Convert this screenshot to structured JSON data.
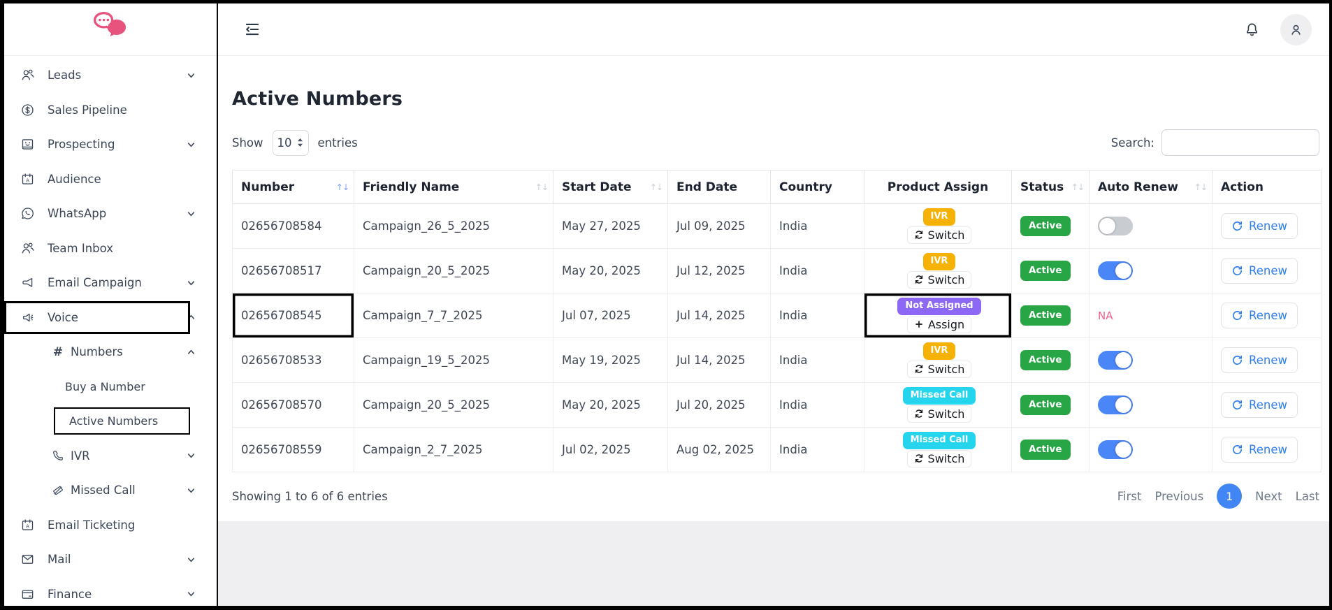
{
  "colors": {
    "brand_pink": "#e8537e",
    "ivr_badge": "#f6b105",
    "missed_call_badge": "#25d4ed",
    "not_assigned_badge": "#8d68f4",
    "active_badge": "#28a544",
    "toggle_on": "#4a86f7",
    "renew_blue": "#2f80ed",
    "na_pink": "#f0608c",
    "pagination_blue": "#4285f4"
  },
  "sidebar": {
    "items": [
      {
        "label": "Leads",
        "icon": "users-icon",
        "chevron": "down",
        "level": 0,
        "highlighted": false
      },
      {
        "label": "Sales Pipeline",
        "icon": "dollar-icon",
        "chevron": null,
        "level": 0,
        "highlighted": false
      },
      {
        "label": "Prospecting",
        "icon": "idcard-icon",
        "chevron": "down",
        "level": 0,
        "highlighted": false
      },
      {
        "label": "Audience",
        "icon": "calendar-icon",
        "chevron": null,
        "level": 0,
        "highlighted": false
      },
      {
        "label": "WhatsApp",
        "icon": "whatsapp-icon",
        "chevron": "down",
        "level": 0,
        "highlighted": false
      },
      {
        "label": "Team Inbox",
        "icon": "users-icon",
        "chevron": null,
        "level": 0,
        "highlighted": false
      },
      {
        "label": "Email Campaign",
        "icon": "megaphone-icon",
        "chevron": "down",
        "level": 0,
        "highlighted": false
      },
      {
        "label": "Voice",
        "icon": "speaker-icon",
        "chevron": "up",
        "level": 0,
        "highlighted": true
      },
      {
        "label": "Numbers",
        "icon": "hash-icon",
        "chevron": "up",
        "level": 1,
        "highlighted": false
      },
      {
        "label": "Buy a Number",
        "icon": null,
        "chevron": null,
        "level": 2,
        "highlighted": false
      },
      {
        "label": "Active Numbers",
        "icon": null,
        "chevron": null,
        "level": 2,
        "highlighted": true
      },
      {
        "label": "IVR",
        "icon": "phone-icon",
        "chevron": "down",
        "level": 1,
        "highlighted": false
      },
      {
        "label": "Missed Call",
        "icon": "missed-call-icon",
        "chevron": "down",
        "level": 1,
        "highlighted": false
      },
      {
        "label": "Email Ticketing",
        "icon": "calendar-icon",
        "chevron": null,
        "level": 0,
        "highlighted": false
      },
      {
        "label": "Mail",
        "icon": "mail-icon",
        "chevron": "down",
        "level": 0,
        "highlighted": false
      },
      {
        "label": "Finance",
        "icon": "wallet-icon",
        "chevron": "down",
        "level": 0,
        "highlighted": false
      }
    ]
  },
  "page": {
    "title": "Active Numbers"
  },
  "controls": {
    "show_label": "Show",
    "page_size": "10",
    "entries_label": "entries",
    "search_label": "Search:",
    "search_value": ""
  },
  "table": {
    "columns": [
      {
        "label": "Number",
        "sort": "active"
      },
      {
        "label": "Friendly Name",
        "sort": "inactive"
      },
      {
        "label": "Start Date",
        "sort": "inactive"
      },
      {
        "label": "End Date",
        "sort": "none"
      },
      {
        "label": "Country",
        "sort": "none"
      },
      {
        "label": "Product Assign",
        "sort": "none"
      },
      {
        "label": "Status",
        "sort": "inactive"
      },
      {
        "label": "Auto Renew",
        "sort": "inactive"
      },
      {
        "label": "Action",
        "sort": "none"
      }
    ],
    "rows": [
      {
        "number": "02656708584",
        "friendly_name": "Campaign_26_5_2025",
        "start_date": "May 27, 2025",
        "end_date": "Jul 09, 2025",
        "country": "India",
        "product": {
          "badge": "IVR",
          "badge_color": "#f6b105",
          "action": "Switch"
        },
        "status": "Active",
        "auto_renew": "off",
        "action": "Renew",
        "annotated": false
      },
      {
        "number": "02656708517",
        "friendly_name": "Campaign_20_5_2025",
        "start_date": "May 20, 2025",
        "end_date": "Jul 12, 2025",
        "country": "India",
        "product": {
          "badge": "IVR",
          "badge_color": "#f6b105",
          "action": "Switch"
        },
        "status": "Active",
        "auto_renew": "on",
        "action": "Renew",
        "annotated": false
      },
      {
        "number": "02656708545",
        "friendly_name": "Campaign_7_7_2025",
        "start_date": "Jul 07, 2025",
        "end_date": "Jul 14, 2025",
        "country": "India",
        "product": {
          "badge": "Not Assigned",
          "badge_color": "#8d68f4",
          "action": "Assign"
        },
        "status": "Active",
        "auto_renew": "na",
        "action": "Renew",
        "annotated": true
      },
      {
        "number": "02656708533",
        "friendly_name": "Campaign_19_5_2025",
        "start_date": "May 19, 2025",
        "end_date": "Jul 14, 2025",
        "country": "India",
        "product": {
          "badge": "IVR",
          "badge_color": "#f6b105",
          "action": "Switch"
        },
        "status": "Active",
        "auto_renew": "on",
        "action": "Renew",
        "annotated": false
      },
      {
        "number": "02656708570",
        "friendly_name": "Campaign_20_5_2025",
        "start_date": "May 20, 2025",
        "end_date": "Jul 20, 2025",
        "country": "India",
        "product": {
          "badge": "Missed Call",
          "badge_color": "#25d4ed",
          "action": "Switch"
        },
        "status": "Active",
        "auto_renew": "on",
        "action": "Renew",
        "annotated": false
      },
      {
        "number": "02656708559",
        "friendly_name": "Campaign_2_7_2025",
        "start_date": "Jul 02, 2025",
        "end_date": "Aug 02, 2025",
        "country": "India",
        "product": {
          "badge": "Missed Call",
          "badge_color": "#25d4ed",
          "action": "Switch"
        },
        "status": "Active",
        "auto_renew": "on",
        "action": "Renew",
        "annotated": false
      }
    ],
    "na_label": "NA",
    "summary": "Showing 1 to 6 of 6 entries"
  },
  "pagination": {
    "first": "First",
    "previous": "Previous",
    "current": "1",
    "next": "Next",
    "last": "Last"
  }
}
